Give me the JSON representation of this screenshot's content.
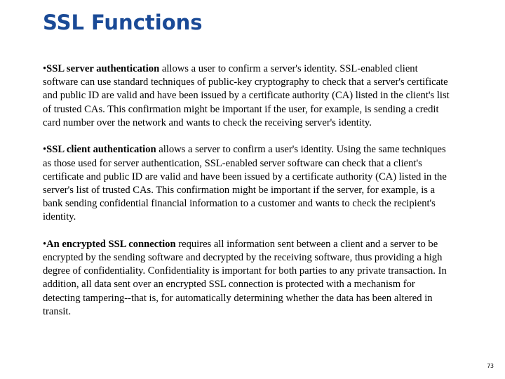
{
  "slide": {
    "title": "SSL Functions",
    "page_number": "73"
  },
  "paragraphs": [
    {
      "bullet": "•",
      "term": "SSL server authentication",
      "text": " allows a user to confirm a server's identity. SSL-enabled client software can use standard techniques of public-key cryptography to check that a server's certificate and public ID are valid and have been issued by a certificate authority (CA) listed in the client's list of trusted CAs. This confirmation might be important if the user, for example, is sending a credit card number over the network and wants to check the receiving server's identity."
    },
    {
      "bullet": "•",
      "term": "SSL client authentication",
      "text": " allows a server to confirm a user's identity. Using the same techniques as those used for server authentication, SSL-enabled server software can check that a client's certificate and public ID are valid and have been issued by a certificate authority (CA) listed in the server's list of trusted CAs. This confirmation might be important if the server, for example, is a bank sending confidential financial information to a customer and wants to check the recipient's identity."
    },
    {
      "bullet": "•",
      "term": "An encrypted SSL connection",
      "text": " requires all information sent between a client and a server to be encrypted by the sending software and decrypted by the receiving software, thus providing a high degree of confidentiality. Confidentiality is important for both parties to any private transaction. In addition, all data sent over an encrypted SSL connection is protected with a mechanism for detecting tampering--that is, for automatically determining whether the data has been altered in transit."
    }
  ]
}
